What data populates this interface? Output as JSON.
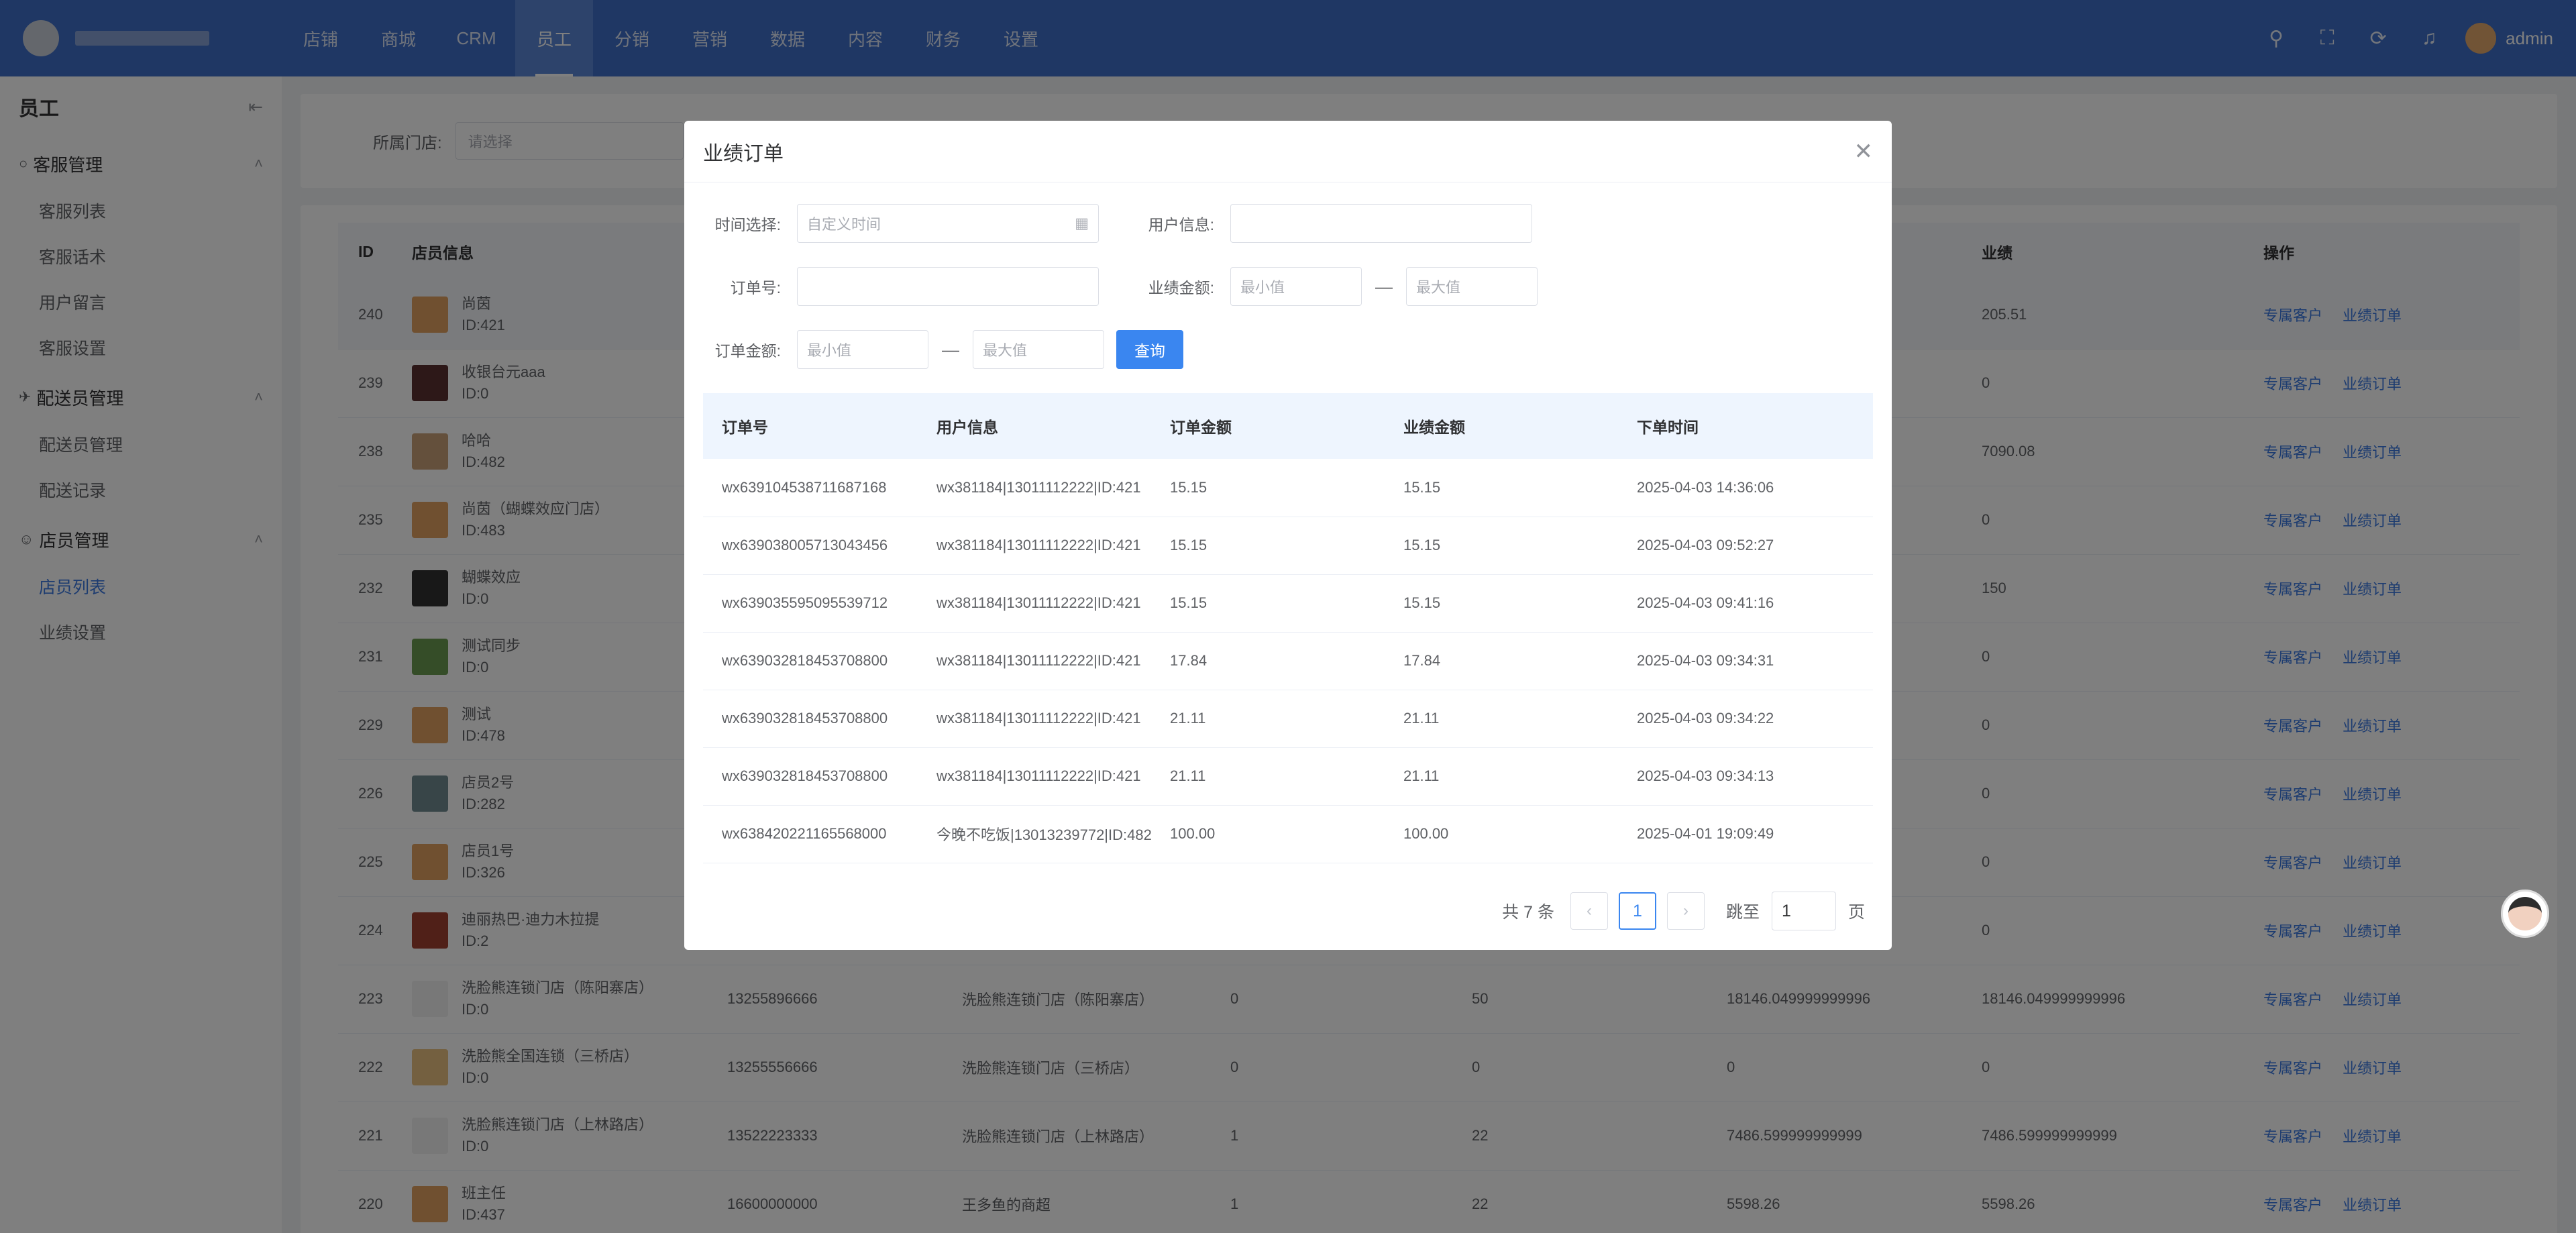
{
  "nav": [
    "店铺",
    "商城",
    "CRM",
    "员工",
    "分销",
    "营销",
    "数据",
    "内容",
    "财务",
    "设置"
  ],
  "nav_active": "员工",
  "header": {
    "user": "admin",
    "icons": [
      "search-icon",
      "fullscreen-icon",
      "refresh-icon",
      "bell-icon"
    ]
  },
  "sidebar": {
    "title": "员工",
    "groups": [
      {
        "title": "客服管理",
        "items": [
          "客服列表",
          "客服话术",
          "用户留言",
          "客服设置"
        ]
      },
      {
        "title": "配送员管理",
        "items": [
          "配送员管理",
          "配送记录"
        ]
      },
      {
        "title": "店员管理",
        "items": [
          "店员列表",
          "业绩设置"
        ]
      }
    ],
    "active_item": "店员列表"
  },
  "filter": {
    "store_label": "所属门店:",
    "store_placeholder": "请选择"
  },
  "staff_table": {
    "headers": [
      "ID",
      "店员信息",
      "",
      "",
      "",
      "",
      "",
      "业绩",
      "操作"
    ],
    "rows": [
      {
        "id": "240",
        "name": "尚茵",
        "uid": "ID:421",
        "phone": "",
        "store": "",
        "c1": "",
        "c2": "",
        "c3": "",
        "perf": "205.51",
        "avatar_color": "#e0a060"
      },
      {
        "id": "239",
        "name": "收银台元aaa",
        "uid": "ID:0",
        "phone": "",
        "store": "",
        "c1": "",
        "c2": "",
        "c3": "",
        "perf": "0",
        "avatar_color": "#5a3030"
      },
      {
        "id": "238",
        "name": "哈哈",
        "uid": "ID:482",
        "phone": "",
        "store": "",
        "c1": "",
        "c2": "",
        "c3": "",
        "perf": "7090.08",
        "avatar_color": "#c8a078"
      },
      {
        "id": "235",
        "name": "尚茵（蝴蝶效应门店）",
        "uid": "ID:483",
        "phone": "",
        "store": "",
        "c1": "",
        "c2": "",
        "c3": "",
        "perf": "0",
        "avatar_color": "#e0a060"
      },
      {
        "id": "232",
        "name": "蝴蝶效应",
        "uid": "ID:0",
        "phone": "",
        "store": "",
        "c1": "",
        "c2": "",
        "c3": "",
        "perf": "150",
        "avatar_color": "#303030"
      },
      {
        "id": "231",
        "name": "测试同步",
        "uid": "ID:0",
        "phone": "",
        "store": "",
        "c1": "",
        "c2": "",
        "c3": "",
        "perf": "0",
        "avatar_color": "#6a9a50"
      },
      {
        "id": "229",
        "name": "测试",
        "uid": "ID:478",
        "phone": "",
        "store": "",
        "c1": "",
        "c2": "",
        "c3": "",
        "perf": "0",
        "avatar_color": "#e0a060"
      },
      {
        "id": "226",
        "name": "店员2号",
        "uid": "ID:282",
        "phone": "",
        "store": "",
        "c1": "",
        "c2": "",
        "c3": "",
        "perf": "0",
        "avatar_color": "#708a90"
      },
      {
        "id": "225",
        "name": "店员1号",
        "uid": "ID:326",
        "phone": "",
        "store": "",
        "c1": "",
        "c2": "",
        "c3": "",
        "perf": "0",
        "avatar_color": "#e0a060"
      },
      {
        "id": "224",
        "name": "迪丽热巴·迪力木拉提",
        "uid": "ID:2",
        "phone": "",
        "store": "",
        "c1": "",
        "c2": "",
        "c3": "",
        "perf": "0",
        "avatar_color": "#a04030"
      },
      {
        "id": "223",
        "name": "洗脸熊连锁门店（陈阳寨店）",
        "uid": "ID:0",
        "phone": "13255896666",
        "store": "洗脸熊连锁门店（陈阳寨店）",
        "c1": "0",
        "c2": "50",
        "c3": "18146.049999999996",
        "perf": "18146.049999999996",
        "avatar_color": "#f0f0f0"
      },
      {
        "id": "222",
        "name": "洗脸熊全国连锁（三桥店）",
        "uid": "ID:0",
        "phone": "13255556666",
        "store": "洗脸熊连锁门店（三桥店）",
        "c1": "0",
        "c2": "0",
        "c3": "0",
        "perf": "0",
        "avatar_color": "#e8c080"
      },
      {
        "id": "221",
        "name": "洗脸熊连锁门店（上林路店）",
        "uid": "ID:0",
        "phone": "13522223333",
        "store": "洗脸熊连锁门店（上林路店）",
        "c1": "1",
        "c2": "22",
        "c3": "7486.599999999999",
        "perf": "7486.599999999999",
        "avatar_color": "#f0f0f0"
      },
      {
        "id": "220",
        "name": "班主任",
        "uid": "ID:437",
        "phone": "16600000000",
        "store": "王多鱼的商超",
        "c1": "1",
        "c2": "22",
        "c3": "5598.26",
        "perf": "5598.26",
        "avatar_color": "#e0a060"
      }
    ],
    "op_links": [
      "专属客户",
      "业绩订单"
    ]
  },
  "dialog": {
    "title": "业绩订单",
    "form": {
      "time_label": "时间选择:",
      "time_placeholder": "自定义时间",
      "user_label": "用户信息:",
      "order_label": "订单号:",
      "perf_amount_label": "业绩金额:",
      "order_amount_label": "订单金额:",
      "min_placeholder": "最小值",
      "max_placeholder": "最大值",
      "dash": "—",
      "query": "查询"
    },
    "table": {
      "headers": [
        "订单号",
        "用户信息",
        "订单金额",
        "业绩金额",
        "下单时间"
      ],
      "rows": [
        [
          "wx639104538711687168",
          "wx381184|13011112222|ID:421",
          "15.15",
          "15.15",
          "2025-04-03 14:36:06"
        ],
        [
          "wx639038005713043456",
          "wx381184|13011112222|ID:421",
          "15.15",
          "15.15",
          "2025-04-03 09:52:27"
        ],
        [
          "wx639035595095539712",
          "wx381184|13011112222|ID:421",
          "15.15",
          "15.15",
          "2025-04-03 09:41:16"
        ],
        [
          "wx639032818453708800",
          "wx381184|13011112222|ID:421",
          "17.84",
          "17.84",
          "2025-04-03 09:34:31"
        ],
        [
          "wx639032818453708800",
          "wx381184|13011112222|ID:421",
          "21.11",
          "21.11",
          "2025-04-03 09:34:22"
        ],
        [
          "wx639032818453708800",
          "wx381184|13011112222|ID:421",
          "21.11",
          "21.11",
          "2025-04-03 09:34:13"
        ],
        [
          "wx638420221165568000",
          "今晚不吃饭|13013239772|ID:482",
          "100.00",
          "100.00",
          "2025-04-01 19:09:49"
        ]
      ]
    },
    "pager": {
      "total": "共 7 条",
      "page": "1",
      "jump_label": "跳至",
      "jump_value": "1",
      "page_unit": "页"
    }
  }
}
